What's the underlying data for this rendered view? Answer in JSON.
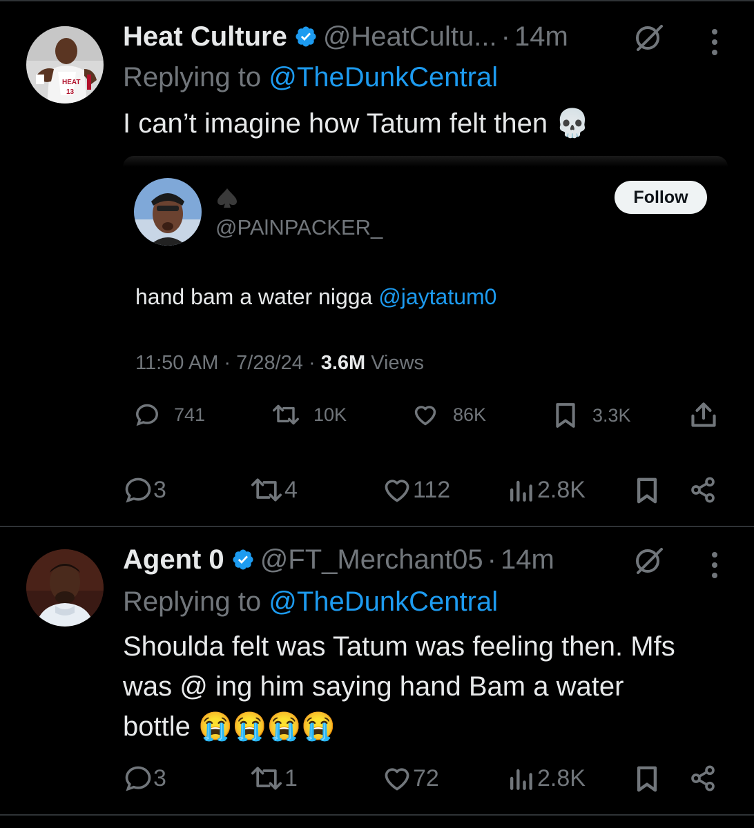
{
  "tweets": [
    {
      "name": "Heat Culture",
      "handle": "@HeatCultu...",
      "dot": "·",
      "time": "14m",
      "replying_prefix": "Replying to ",
      "replying_to": "@TheDunkCentral",
      "text": "I can’t imagine how Tatum felt then 💀",
      "quote": {
        "handle": "@PAlNPACKER_",
        "follow_label": "Follow",
        "text": "hand bam a water nigga ",
        "mention": "@jaytatum0",
        "meta_time": "11:50 AM · 7/28/24 · ",
        "meta_views_count": "3.6M",
        "meta_views_label": " Views",
        "replies": "741",
        "reposts": "10K",
        "likes": "86K",
        "bookmarks": "3.3K"
      },
      "replies": "3",
      "reposts": "4",
      "likes": "112",
      "views": "2.8K"
    },
    {
      "name": "Agent 0",
      "handle": "@FT_Merchant05",
      "dot": "·",
      "time": "14m",
      "replying_prefix": "Replying to ",
      "replying_to": "@TheDunkCentral",
      "text_line1": "Shoulda felt was Tatum was feeling then. Mfs",
      "text_line2": "was @ ing him saying hand Bam a water",
      "text_line3": "bottle 😭😭😭😭",
      "replies": "3",
      "reposts": "1",
      "likes": "72",
      "views": "2.8K"
    }
  ],
  "icons": {
    "verified": "verified-badge-icon",
    "grok": "grok-icon",
    "more": "more-icon",
    "reply": "reply-icon",
    "repost": "repost-icon",
    "like": "like-icon",
    "views": "views-icon",
    "bookmark": "bookmark-icon",
    "share": "share-icon",
    "spade": "spade-icon"
  },
  "colors": {
    "background": "#000000",
    "text": "#e7e9ea",
    "secondary": "#71767b",
    "link": "#1d9bf0",
    "divider": "#2f3336"
  }
}
